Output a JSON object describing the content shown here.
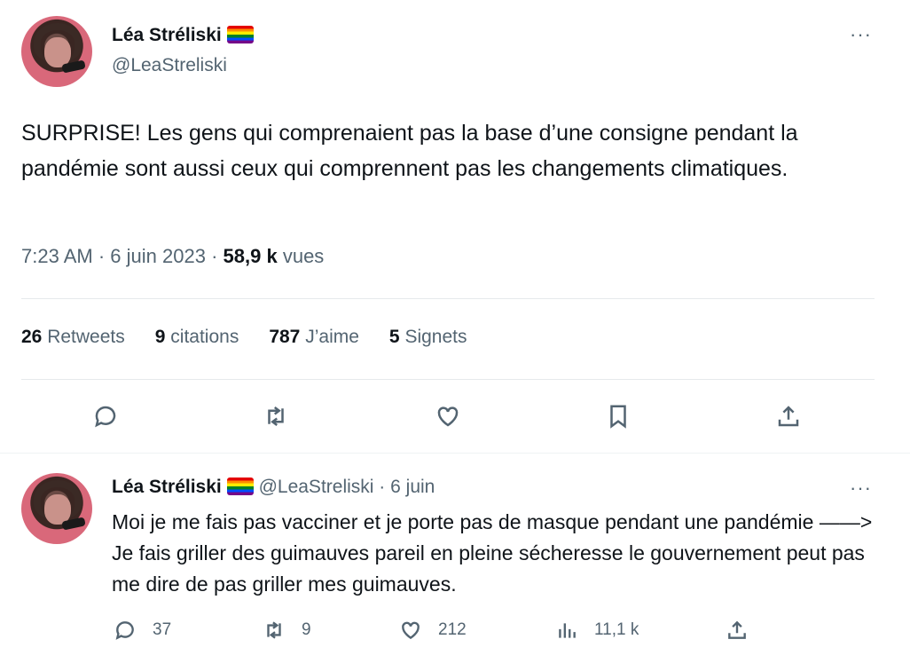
{
  "tweet": {
    "author_name": "Léa Stréliski",
    "author_handle": "@LeaStreliski",
    "more_label": "···",
    "text": "SURPRISE! Les gens qui comprenaient pas la base d’une consigne pendant la pandémie sont aussi ceux qui comprennent pas les changements climatiques.",
    "time": "7:23 AM",
    "date": "6 juin 2023",
    "views_count": "58,9 k",
    "views_label": "vues",
    "stats": {
      "retweets_count": "26",
      "retweets_label": "Retweets",
      "quotes_count": "9",
      "quotes_label": "citations",
      "likes_count": "787",
      "likes_label": "J’aime",
      "bookmarks_count": "5",
      "bookmarks_label": "Signets"
    }
  },
  "reply": {
    "author_name": "Léa Stréliski",
    "author_handle": "@LeaStreliski",
    "date": "6 juin",
    "more_label": "···",
    "text": "Moi je me fais pas vacciner et je porte pas de masque pendant une pandémie ——> Je fais griller des guimauves pareil en pleine sécheresse le gouvernement peut pas me dire de pas griller mes guimauves.",
    "replies": "37",
    "retweets": "9",
    "likes": "212",
    "views": "11,1 k"
  },
  "separator": "·",
  "icons": [
    "reply-icon",
    "retweet-icon",
    "like-icon",
    "bookmark-icon",
    "share-icon",
    "views-icon",
    "pride-flag-icon",
    "more-icon"
  ]
}
